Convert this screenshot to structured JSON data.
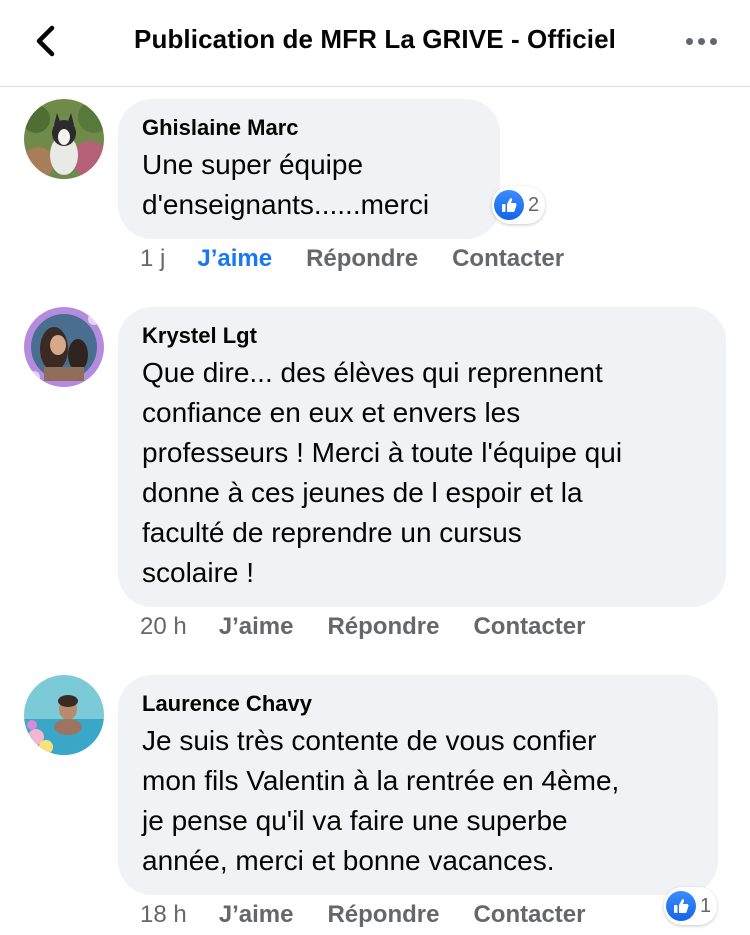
{
  "header": {
    "title": "Publication de MFR La GRIVE - Officiel"
  },
  "comments": [
    {
      "author": "Ghislaine Marc",
      "text": "Une super équipe\nd'enseignants......merci",
      "time": "1 j",
      "like": "J’aime",
      "reply": "Répondre",
      "contact": "Contacter",
      "reactions": "2"
    },
    {
      "author": "Krystel Lgt",
      "text": "Que dire... des élèves qui reprennent\nconfiance en eux et envers les\nprofesseurs ! Merci à toute l'équipe qui\ndonne à ces jeunes de l espoir et la\nfaculté de reprendre un cursus\nscolaire !",
      "time": "20 h",
      "like": "J’aime",
      "reply": "Répondre",
      "contact": "Contacter"
    },
    {
      "author": "Laurence Chavy",
      "text": "Je suis très contente de vous confier\nmon fils Valentin à la rentrée en 4ème,\nje pense qu'il va faire une superbe\nannée, merci et bonne vacances.",
      "time": "18 h",
      "like": "J’aime",
      "reply": "Répondre",
      "contact": "Contacter",
      "reactions": "1"
    }
  ],
  "colors": {
    "accent": "#1877f2",
    "bubble": "#f0f2f5",
    "muted_text": "#65676b"
  },
  "icons": [
    "back-arrow-icon",
    "more-dots-icon",
    "like-thumb-icon"
  ]
}
